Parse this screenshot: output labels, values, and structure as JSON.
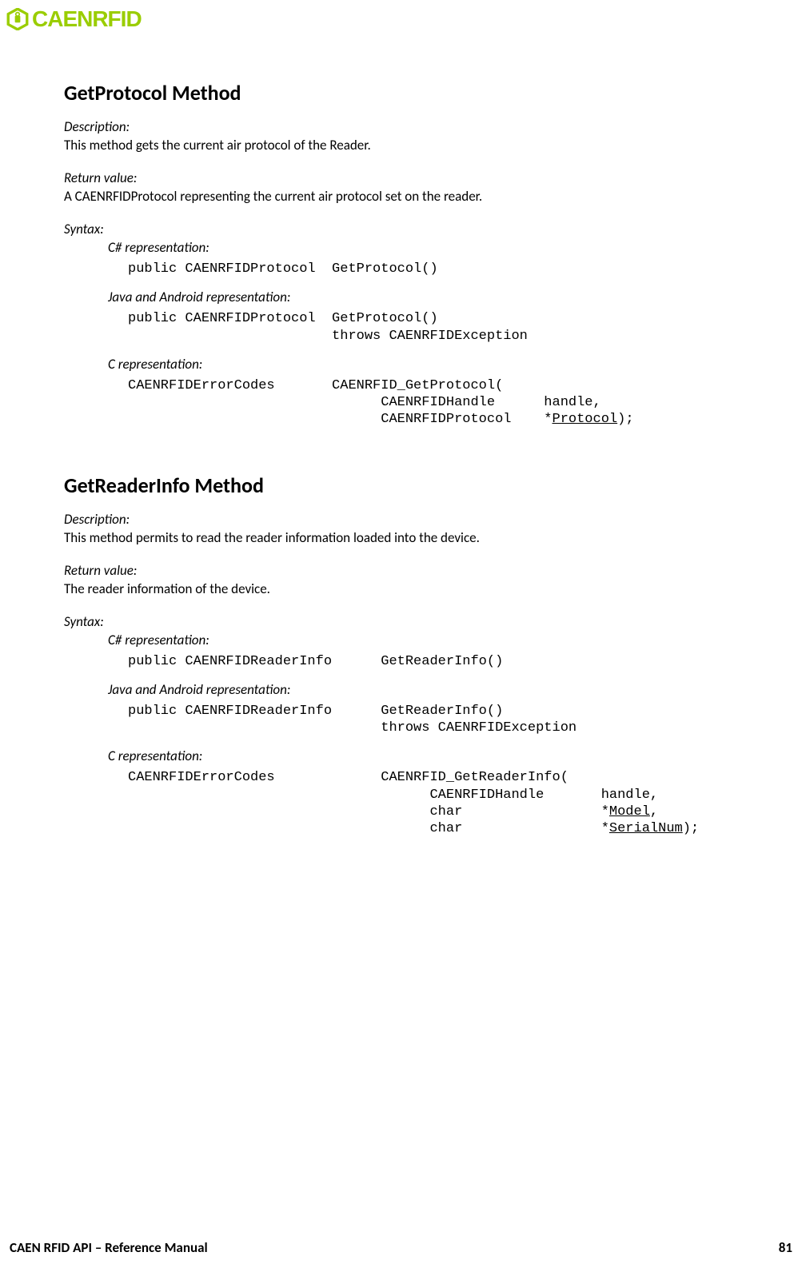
{
  "brand": {
    "name": "CAENRFID"
  },
  "methods": [
    {
      "title": "GetProtocol Method",
      "description_label": "Description:",
      "description_text": "This method gets the current air protocol of the Reader.",
      "return_label": "Return value:",
      "return_text": "A CAENRFIDProtocol representing the current air protocol set on the reader.",
      "syntax_label": "Syntax:",
      "reps": [
        {
          "label": "C# representation:",
          "code": "public CAENRFIDProtocol  GetProtocol()"
        },
        {
          "label": "Java and Android representation:",
          "code": "public CAENRFIDProtocol  GetProtocol()\n                         throws CAENRFIDException"
        },
        {
          "label": "C representation:",
          "code": "CAENRFIDErrorCodes       CAENRFID_GetProtocol(\n                               CAENRFIDHandle      handle,\n                               CAENRFIDProtocol    *",
          "code_u1": "Protocol",
          "code_tail": ");"
        }
      ]
    },
    {
      "title": "GetReaderInfo Method",
      "description_label": "Description:",
      "description_text": "This method permits to read the reader information loaded into the device.",
      "return_label": "Return value:",
      "return_text": "The reader information of the device.",
      "syntax_label": "Syntax:",
      "reps": [
        {
          "label": "C# representation:",
          "code": "public CAENRFIDReaderInfo      GetReaderInfo()"
        },
        {
          "label": "Java and Android representation:",
          "code": "public CAENRFIDReaderInfo      GetReaderInfo()\n                               throws CAENRFIDException"
        },
        {
          "label": "C representation:",
          "code": "CAENRFIDErrorCodes             CAENRFID_GetReaderInfo(\n                                     CAENRFIDHandle       handle,\n                                     char                 *",
          "code_u1": "Model",
          "code_mid": ",\n                                     char                 *",
          "code_u2": "SerialNum",
          "code_tail": ");"
        }
      ]
    }
  ],
  "footer": {
    "left": "CAEN RFID API – Reference Manual",
    "right": "81"
  }
}
